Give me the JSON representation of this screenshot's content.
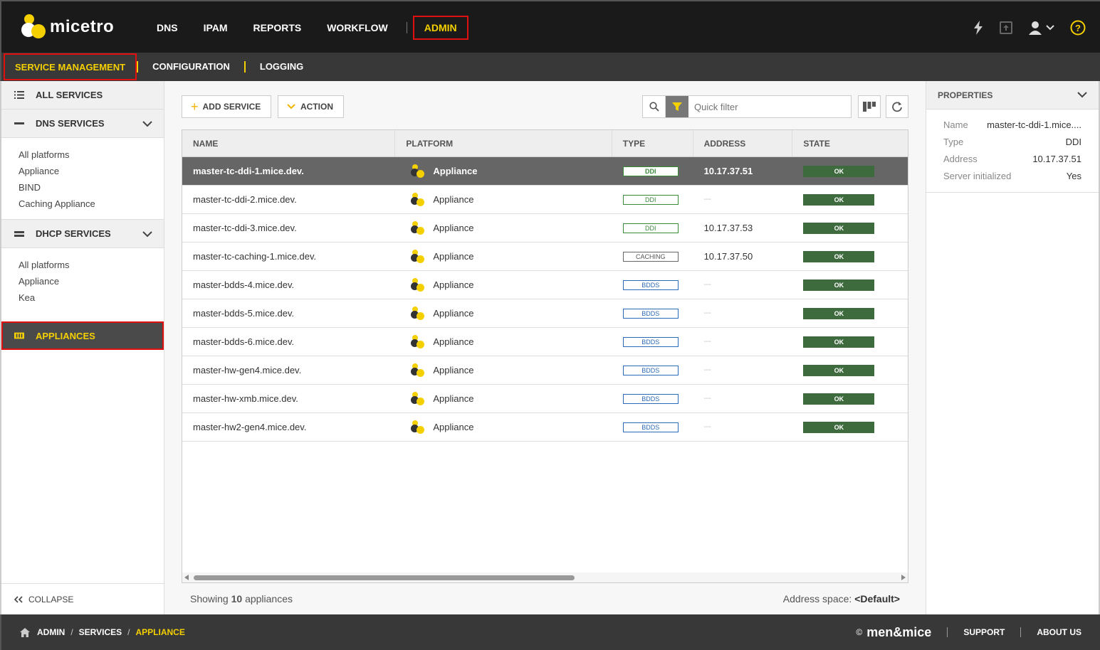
{
  "brand": {
    "name": "micetro"
  },
  "main_nav": [
    {
      "label": "DNS"
    },
    {
      "label": "IPAM"
    },
    {
      "label": "REPORTS"
    },
    {
      "label": "WORKFLOW"
    },
    {
      "label": "ADMIN",
      "active": true
    }
  ],
  "top_icons": [
    "lightning-icon",
    "task-icon",
    "user-icon",
    "help-icon"
  ],
  "sub_nav": [
    {
      "label": "SERVICE MANAGEMENT",
      "active": true
    },
    {
      "label": "CONFIGURATION"
    },
    {
      "label": "LOGGING"
    }
  ],
  "sidebar": {
    "all_services": "ALL SERVICES",
    "dns": {
      "title": "DNS SERVICES",
      "items": [
        "All platforms",
        "Appliance",
        "BIND",
        "Caching Appliance"
      ]
    },
    "dhcp": {
      "title": "DHCP SERVICES",
      "items": [
        "All platforms",
        "Appliance",
        "Kea"
      ]
    },
    "appliances": "APPLIANCES",
    "collapse": "COLLAPSE"
  },
  "toolbar": {
    "add_service": "ADD SERVICE",
    "action": "ACTION",
    "filter_placeholder": "Quick filter"
  },
  "table": {
    "columns": [
      "NAME",
      "PLATFORM",
      "TYPE",
      "ADDRESS",
      "STATE"
    ],
    "rows": [
      {
        "name": "master-tc-ddi-1.mice.dev.",
        "platform": "Appliance",
        "type": "DDI",
        "type_class": "ddi",
        "address": "10.17.37.51",
        "state": "OK",
        "selected": true
      },
      {
        "name": "master-tc-ddi-2.mice.dev.",
        "platform": "Appliance",
        "type": "DDI",
        "type_class": "ddi",
        "address": "---",
        "state": "OK"
      },
      {
        "name": "master-tc-ddi-3.mice.dev.",
        "platform": "Appliance",
        "type": "DDI",
        "type_class": "ddi",
        "address": "10.17.37.53",
        "state": "OK"
      },
      {
        "name": "master-tc-caching-1.mice.dev.",
        "platform": "Appliance",
        "type": "CACHING",
        "type_class": "caching",
        "address": "10.17.37.50",
        "state": "OK"
      },
      {
        "name": "master-bdds-4.mice.dev.",
        "platform": "Appliance",
        "type": "BDDS",
        "type_class": "bdds",
        "address": "---",
        "state": "OK"
      },
      {
        "name": "master-bdds-5.mice.dev.",
        "platform": "Appliance",
        "type": "BDDS",
        "type_class": "bdds",
        "address": "---",
        "state": "OK"
      },
      {
        "name": "master-bdds-6.mice.dev.",
        "platform": "Appliance",
        "type": "BDDS",
        "type_class": "bdds",
        "address": "---",
        "state": "OK"
      },
      {
        "name": "master-hw-gen4.mice.dev.",
        "platform": "Appliance",
        "type": "BDDS",
        "type_class": "bdds",
        "address": "---",
        "state": "OK"
      },
      {
        "name": "master-hw-xmb.mice.dev.",
        "platform": "Appliance",
        "type": "BDDS",
        "type_class": "bdds",
        "address": "---",
        "state": "OK"
      },
      {
        "name": "master-hw2-gen4.mice.dev.",
        "platform": "Appliance",
        "type": "BDDS",
        "type_class": "bdds",
        "address": "---",
        "state": "OK"
      }
    ]
  },
  "footer": {
    "showing_prefix": "Showing",
    "showing_count": "10",
    "showing_suffix": "appliances",
    "address_space_label": "Address space:",
    "address_space_value": "<Default>"
  },
  "properties": {
    "title": "PROPERTIES",
    "rows": [
      {
        "key": "Name",
        "value": "master-tc-ddi-1.mice...."
      },
      {
        "key": "Type",
        "value": "DDI"
      },
      {
        "key": "Address",
        "value": "10.17.37.51"
      },
      {
        "key": "Server initialized",
        "value": "Yes"
      }
    ]
  },
  "breadcrumb": [
    "ADMIN",
    "SERVICES",
    "APPLIANCE"
  ],
  "bottom": {
    "copyright": "©",
    "company": "men&mice",
    "support": "SUPPORT",
    "about": "ABOUT US"
  },
  "colors": {
    "accent": "#f5d000",
    "highlight_border": "#e01010",
    "ok_green": "#3d6b3d"
  }
}
